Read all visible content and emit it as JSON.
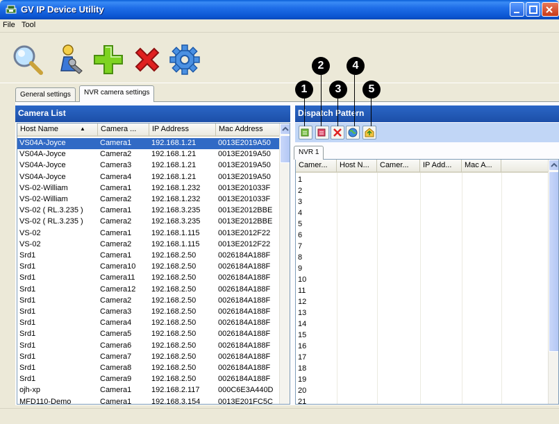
{
  "window": {
    "title": "GV IP Device Utility"
  },
  "menu": [
    {
      "label": "File"
    },
    {
      "label": "Tool"
    }
  ],
  "toolbar": {
    "icons": [
      "search-icon",
      "user-config-icon",
      "add-icon",
      "delete-icon",
      "settings-gear-icon"
    ]
  },
  "tabs": [
    {
      "label": "General settings"
    },
    {
      "label": "NVR camera settings",
      "active": true
    }
  ],
  "camera_list": {
    "title": "Camera List",
    "columns": [
      "Host Name",
      "Camera ...",
      "IP Address",
      "Mac Address"
    ],
    "sort_indicator": "▲",
    "rows": [
      [
        "VS04A-Joyce",
        "Camera1",
        "192.168.1.21",
        "0013E2019A50"
      ],
      [
        "VS04A-Joyce",
        "Camera2",
        "192.168.1.21",
        "0013E2019A50"
      ],
      [
        "VS04A-Joyce",
        "Camera3",
        "192.168.1.21",
        "0013E2019A50"
      ],
      [
        "VS04A-Joyce",
        "Camera4",
        "192.168.1.21",
        "0013E2019A50"
      ],
      [
        "VS-02-William",
        "Camera1",
        "192.168.1.232",
        "0013E201033F"
      ],
      [
        "VS-02-William",
        "Camera2",
        "192.168.1.232",
        "0013E201033F"
      ],
      [
        "VS-02 ( RL.3.235 )",
        "Camera1",
        "192.168.3.235",
        "0013E2012BBE"
      ],
      [
        "VS-02 ( RL.3.235 )",
        "Camera2",
        "192.168.3.235",
        "0013E2012BBE"
      ],
      [
        "VS-02",
        "Camera1",
        "192.168.1.115",
        "0013E2012F22"
      ],
      [
        "VS-02",
        "Camera2",
        "192.168.1.115",
        "0013E2012F22"
      ],
      [
        "Srd1",
        "Camera1",
        "192.168.2.50",
        "0026184A188F"
      ],
      [
        "Srd1",
        "Camera10",
        "192.168.2.50",
        "0026184A188F"
      ],
      [
        "Srd1",
        "Camera11",
        "192.168.2.50",
        "0026184A188F"
      ],
      [
        "Srd1",
        "Camera12",
        "192.168.2.50",
        "0026184A188F"
      ],
      [
        "Srd1",
        "Camera2",
        "192.168.2.50",
        "0026184A188F"
      ],
      [
        "Srd1",
        "Camera3",
        "192.168.2.50",
        "0026184A188F"
      ],
      [
        "Srd1",
        "Camera4",
        "192.168.2.50",
        "0026184A188F"
      ],
      [
        "Srd1",
        "Camera5",
        "192.168.2.50",
        "0026184A188F"
      ],
      [
        "Srd1",
        "Camera6",
        "192.168.2.50",
        "0026184A188F"
      ],
      [
        "Srd1",
        "Camera7",
        "192.168.2.50",
        "0026184A188F"
      ],
      [
        "Srd1",
        "Camera8",
        "192.168.2.50",
        "0026184A188F"
      ],
      [
        "Srd1",
        "Camera9",
        "192.168.2.50",
        "0026184A188F"
      ],
      [
        "ojh-xp",
        "Camera1",
        "192.168.2.117",
        "000C6E3A440D"
      ],
      [
        "MFD110-Demo",
        "Camera1",
        "192.168.3.154",
        "0013E201FC5C"
      ]
    ],
    "selected_row": 0
  },
  "dispatch": {
    "title": "Dispatch Pattern",
    "buttons": [
      {
        "icon": "add-row-icon",
        "callout": "1"
      },
      {
        "icon": "remove-row-icon",
        "callout": "2"
      },
      {
        "icon": "delete-x-icon",
        "callout": "3"
      },
      {
        "icon": "globe-icon",
        "callout": "4"
      },
      {
        "icon": "export-icon",
        "callout": "5"
      }
    ],
    "nvr_tab": "NVR 1",
    "columns": [
      "Camer...",
      "Host N...",
      "Camer...",
      "IP Add...",
      "Mac A..."
    ],
    "row_numbers": [
      "1",
      "2",
      "3",
      "4",
      "5",
      "6",
      "7",
      "8",
      "9",
      "10",
      "11",
      "12",
      "13",
      "14",
      "15",
      "16",
      "17",
      "18",
      "19",
      "20",
      "21"
    ]
  },
  "colors": {
    "titlebar": "#0b55d2",
    "panel_header": "#1c4fa8",
    "selection": "#316ac5",
    "dispatch_toolbar": "#c1d6f6"
  }
}
